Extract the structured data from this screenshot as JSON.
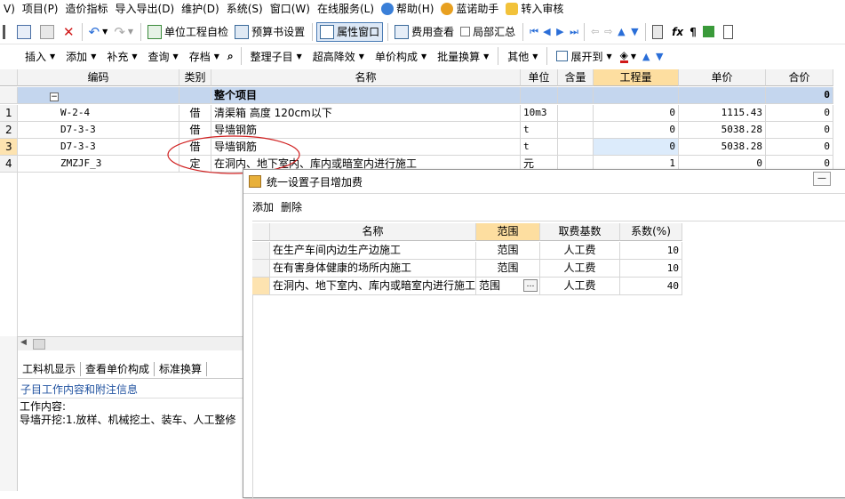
{
  "menu": [
    "V)",
    "项目(P)",
    "造价指标",
    "导入导出(D)",
    "维护(D)",
    "系统(S)",
    "窗口(W)",
    "在线服务(L)",
    "帮助(H)",
    "蓝诺助手",
    "转入审核"
  ],
  "toolbar1": {
    "unit_check": "单位工程自检",
    "budget_settings": "预算书设置",
    "property_window": "属性窗口",
    "fee_view": "费用查看",
    "local_summary": "局部汇总"
  },
  "toolbar2": {
    "items": [
      "插入",
      "添加",
      "补充",
      "查询",
      "存档",
      "整理子目",
      "超高降效",
      "单价构成",
      "批量换算",
      "其他",
      "展开到"
    ]
  },
  "grid": {
    "headers": [
      "编码",
      "类别",
      "名称",
      "单位",
      "含量",
      "工程量",
      "单价",
      "合价"
    ],
    "group_row": {
      "name": "整个项目",
      "total": "0"
    },
    "rows": [
      {
        "no": "1",
        "code": "W-2-4",
        "type": "借",
        "name": "清渠箱 高度 120cm以下",
        "unit": "10m3",
        "qty": "0",
        "price": "1115.43",
        "total": "0"
      },
      {
        "no": "2",
        "code": "D7-3-3",
        "type": "借",
        "name": "导墙钢筋",
        "unit": "t",
        "qty": "0",
        "price": "5038.28",
        "total": "0"
      },
      {
        "no": "3",
        "code": "D7-3-3",
        "type": "借",
        "name": "导墙钢筋",
        "unit": "t",
        "qty": "0",
        "price": "5038.28",
        "total": "0"
      },
      {
        "no": "4",
        "code": "ZMZJF_3",
        "type": "定",
        "name": "在洞内、地下室内、库内或暗室内进行施工",
        "unit": "元",
        "qty": "1",
        "price": "0",
        "total": "0"
      }
    ]
  },
  "lower": {
    "tabs": [
      "工料机显示",
      "查看单价构成",
      "标准换算"
    ],
    "info_title": "子目工作内容和附注信息",
    "work_label": "工作内容:",
    "work_text": "导墙开挖:1.放样、机械挖土、装车、人工整修"
  },
  "dialog": {
    "title": "统一设置子目增加费",
    "add": "添加",
    "delete": "删除",
    "headers": [
      "名称",
      "范围",
      "取费基数",
      "系数(%)"
    ],
    "rows": [
      {
        "name": "在生产车间内边生产边施工",
        "scope": "范围",
        "base": "人工费",
        "coef": "10"
      },
      {
        "name": "在有害身体健康的场所内施工",
        "scope": "范围",
        "base": "人工费",
        "coef": "10"
      },
      {
        "name": "在洞内、地下室内、库内或暗室内进行施工",
        "scope": "范围",
        "base": "人工费",
        "coef": "40"
      }
    ],
    "ellipsis": "…"
  },
  "colors": {
    "highlight_col": "#fddea0",
    "selected_row": "#fde3b0",
    "group_bg": "#c4d6ee",
    "annotation": "#d02020"
  }
}
